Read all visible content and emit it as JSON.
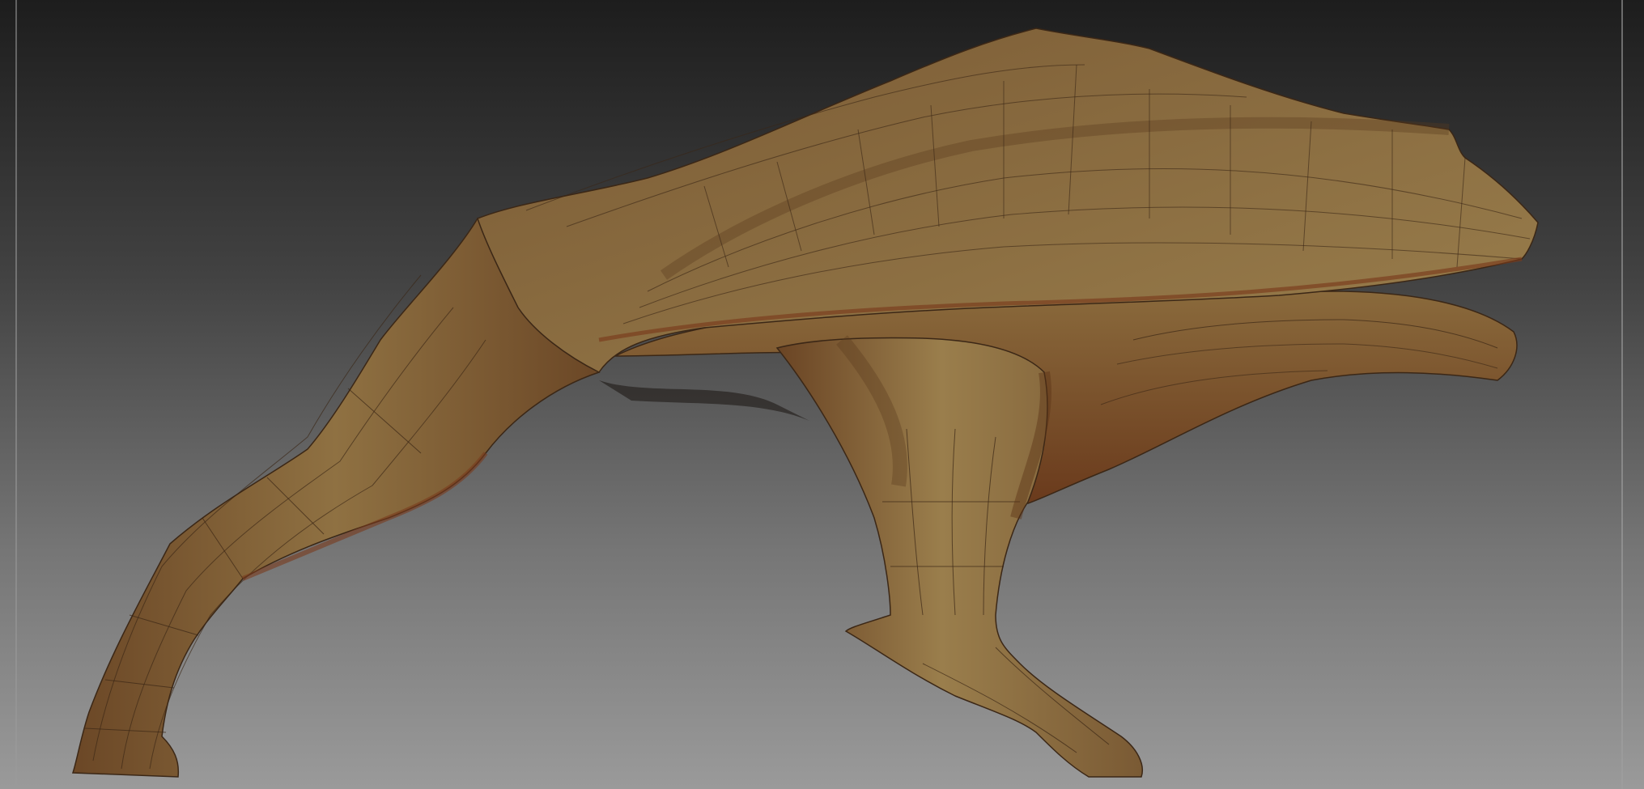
{
  "viewport": {
    "background_top": "#1d1d1d",
    "background_bottom": "#9a9a9a",
    "frame_line": "#9a9a9a"
  },
  "model": {
    "icon": "sculpt-mesh",
    "shading": "polyframe",
    "colors": {
      "base": "#7a5a34",
      "highlight": "#8f7142",
      "light": "#9c8050",
      "shadow": "#6a4424",
      "rim": "#7a3a1c",
      "wire": "#3b2716"
    }
  }
}
